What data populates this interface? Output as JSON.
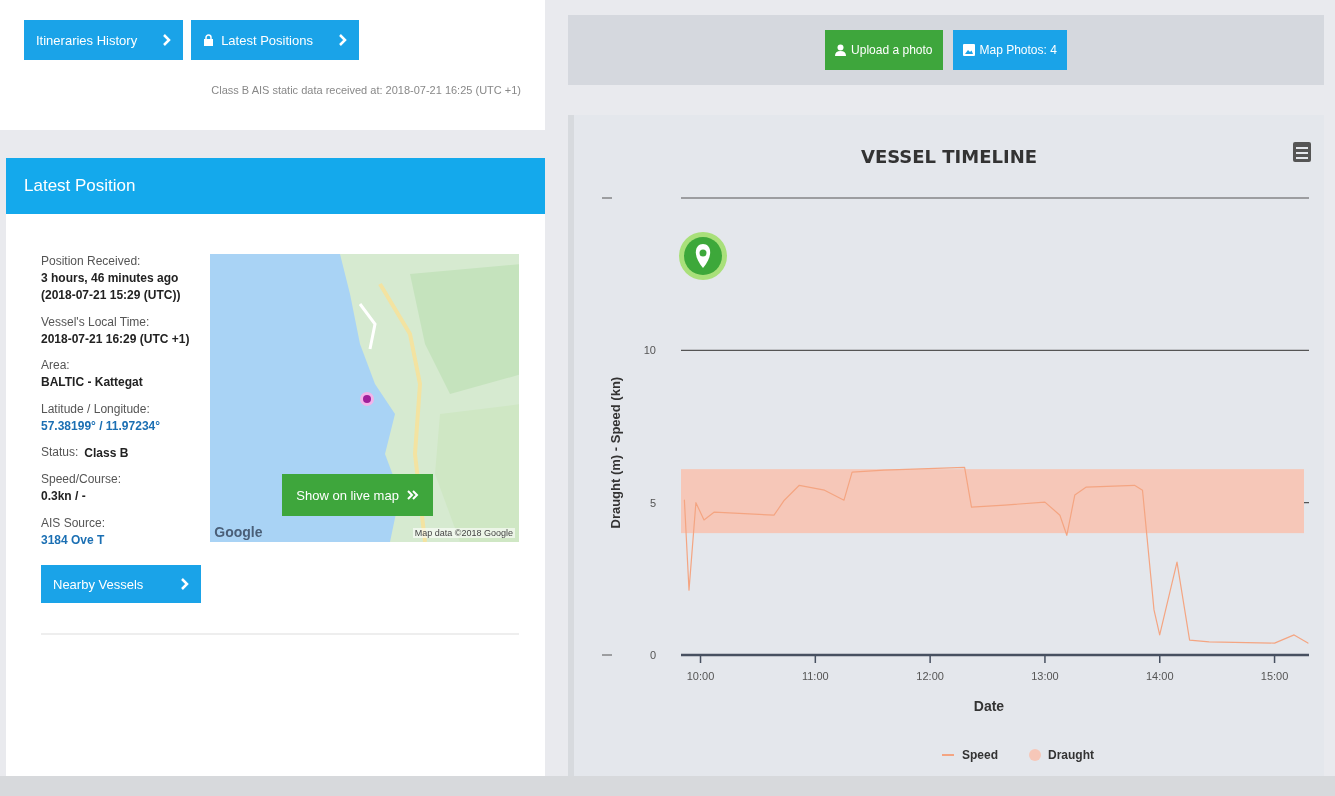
{
  "top_buttons": [
    {
      "label": "Itineraries History"
    },
    {
      "label": "Latest Positions"
    }
  ],
  "static_note": "Class B AIS static data received at: 2018-07-21 16:25 (UTC +1)",
  "panel": {
    "title": "Latest Position",
    "fields": [
      {
        "label": "Position Received:",
        "value": "3 hours, 46 minutes ago (2018-07-21 15:29 (UTC))",
        "kind": "stacked"
      },
      {
        "label": "Vessel's Local Time:",
        "value": "2018-07-21 16:29 (UTC +1)",
        "kind": "stacked"
      },
      {
        "label": "Area:",
        "value": "BALTIC - Kattegat",
        "kind": "stacked"
      },
      {
        "label": "Latitude / Longitude:",
        "value": "57.38199° / 11.97234°",
        "kind": "link"
      },
      {
        "label": "Status:",
        "value": "Class B",
        "kind": "inline"
      },
      {
        "label": "Speed/Course:",
        "value": "0.3kn / -",
        "kind": "stacked"
      },
      {
        "label": "AIS Source:",
        "value": "3184 Ove T",
        "kind": "link"
      }
    ],
    "map": {
      "kind": "picture",
      "button": "Show on live map",
      "attribution": "Map data ©2018 Google",
      "logo": "Google"
    },
    "nearby_button": "Nearby Vessels"
  },
  "photo_buttons": [
    {
      "label": "Upload a photo",
      "kind": "upload"
    },
    {
      "label": "Map Photos: 4",
      "kind": "photos"
    }
  ],
  "timeline": {
    "chart_data": {
      "type": "line",
      "title": "VESSEL TIMELINE",
      "xlabel": "Date",
      "ylabel": "Draught (m) - Speed (kn)",
      "x": [
        9.86,
        9.9,
        9.96,
        10.03,
        10.12,
        10.64,
        10.73,
        10.86,
        11.08,
        11.25,
        11.32,
        11.6,
        12.3,
        12.36,
        12.65,
        13.0,
        13.13,
        13.19,
        13.26,
        13.36,
        13.78,
        13.85,
        13.95,
        14.0,
        14.15,
        14.26,
        14.43,
        15.0,
        15.17,
        15.29
      ],
      "series": [
        {
          "name": "Speed",
          "color": "#f4a582",
          "values": [
            5.08,
            2.13,
            5.0,
            4.43,
            4.69,
            4.59,
            5.08,
            5.57,
            5.41,
            5.08,
            6.0,
            6.07,
            6.16,
            4.85,
            4.92,
            5.02,
            4.59,
            3.93,
            5.25,
            5.51,
            5.57,
            5.41,
            1.48,
            0.66,
            3.05,
            0.49,
            0.43,
            0.39,
            0.66,
            0.39
          ]
        }
      ],
      "legend": "bottom",
      "xlim": [
        9.83,
        15.3
      ],
      "ylim": [
        0,
        15
      ],
      "xticks": [
        {
          "value": 10,
          "label": "10:00"
        },
        {
          "value": 11,
          "label": "11:00"
        },
        {
          "value": 12,
          "label": "12:00"
        },
        {
          "value": 13,
          "label": "13:00"
        },
        {
          "value": 14,
          "label": "14:00"
        },
        {
          "value": 15,
          "label": "15:00"
        }
      ],
      "yticks": [
        0,
        5,
        10
      ],
      "bands": [
        {
          "axis": "y",
          "from": 4,
          "to": 6.1,
          "color": "#f6c7b8",
          "label": "Draught"
        }
      ]
    }
  }
}
